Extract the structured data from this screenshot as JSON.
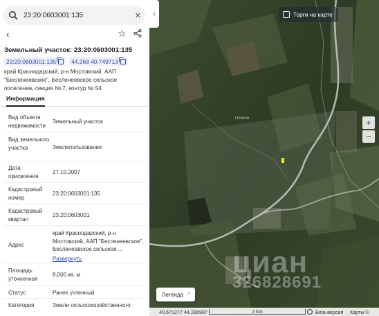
{
  "search": {
    "value": "23:20:0603001:135"
  },
  "parcel": {
    "title": "Земельный участок: 23:20:0603001:135",
    "chips": [
      {
        "text": "23:20:0603001:135"
      },
      {
        "text": "44.268 40.749713"
      }
    ],
    "address": "край Краснодарский, р-н Мостовский, ААП \"Бесленеевское\", Бесленеевское сельское поселение, секция № 7, контур № 54"
  },
  "tabs": [
    {
      "label": "Информация"
    }
  ],
  "rows": [
    {
      "label": "Вид объекта недвижимости",
      "value": "Земельный участок"
    },
    {
      "label": "Вид земельного участка",
      "value": "Землепользование"
    },
    {
      "label": "Дата присвоения",
      "value": "27.10.2007"
    },
    {
      "label": "Кадастровый номер",
      "value": "23:20:0603001:135"
    },
    {
      "label": "Кадастровый квартал",
      "value": "23:20:0603001"
    },
    {
      "label": "Адрес",
      "value": "край Краснодарский, р-н Мостовский, ААП \"Бесленеевское\", Бесленеевское сельское ...",
      "more": "Развернуть"
    },
    {
      "label": "Площадь уточненная",
      "value": "8,000 кв. м"
    },
    {
      "label": "Статус",
      "value": "Ранее учтенный"
    },
    {
      "label": "Категория",
      "value": "Земли сельскохозяйственного"
    }
  ],
  "map": {
    "trade_toggle": "Торги на карте",
    "legend": "Легенда",
    "watermark": "циан",
    "watermark_id": "326828691",
    "place_label": "Uzdece",
    "zoom_in": "+",
    "zoom_out": "−",
    "coords": "40.671277   44.286987",
    "scale": "2 km",
    "beta": "Beta-версия",
    "maps_label": "Карты ©"
  },
  "icons": {
    "search": "search-icon",
    "clear": "close-icon",
    "back": "chevron-left-icon",
    "favorite": "star-icon",
    "share": "share-icon",
    "copy": "copy-icon",
    "collapse": "chevron-left-icon"
  },
  "colors": {
    "accent": "#2b48a6",
    "chip_bg": "#eef1fb",
    "map_dark": "#2d3a24"
  }
}
